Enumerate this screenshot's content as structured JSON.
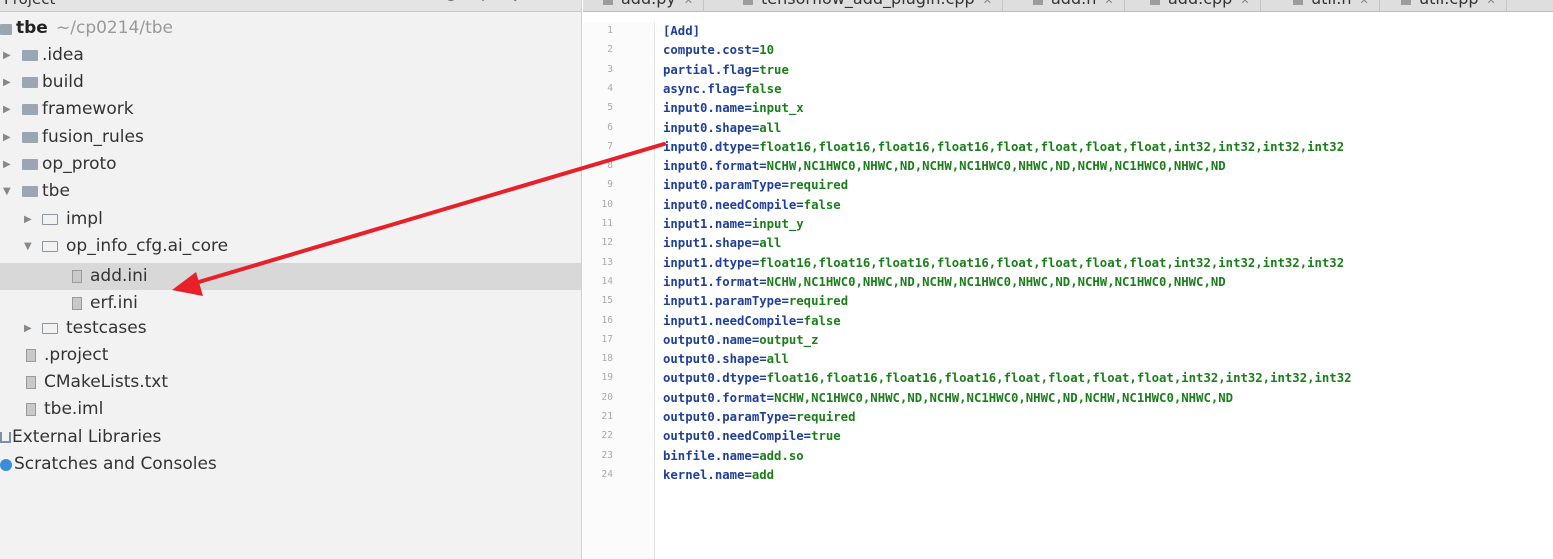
{
  "project_panel": {
    "title": "Project",
    "tree": [
      {
        "label": "tbe",
        "path": "~/cp0214/tbe",
        "kind": "root"
      },
      {
        "label": ".idea",
        "kind": "folder"
      },
      {
        "label": "build",
        "kind": "folder"
      },
      {
        "label": "framework",
        "kind": "folder"
      },
      {
        "label": "fusion_rules",
        "kind": "folder"
      },
      {
        "label": "op_proto",
        "kind": "folder"
      },
      {
        "label": "tbe",
        "kind": "folder-open"
      },
      {
        "label": "impl",
        "kind": "subfolder"
      },
      {
        "label": "op_info_cfg.ai_core",
        "kind": "subfolder-open"
      },
      {
        "label": "add.ini",
        "kind": "file",
        "selected": true
      },
      {
        "label": "erf.ini",
        "kind": "file"
      },
      {
        "label": "testcases",
        "kind": "subfolder"
      },
      {
        "label": ".project",
        "kind": "file"
      },
      {
        "label": "CMakeLists.txt",
        "kind": "file"
      },
      {
        "label": "tbe.iml",
        "kind": "file"
      },
      {
        "label": "External Libraries",
        "kind": "library"
      },
      {
        "label": "Scratches and Consoles",
        "kind": "scratch"
      }
    ]
  },
  "editor": {
    "tabs": [
      {
        "label": "add.py"
      },
      {
        "label": "tensorflow_add_plugin.cpp"
      },
      {
        "label": "add.h"
      },
      {
        "label": "add.cpp"
      },
      {
        "label": "util.h"
      },
      {
        "label": "util.cpp"
      }
    ],
    "lines": [
      {
        "n": "1",
        "k": "[Add]",
        "v": ""
      },
      {
        "n": "2",
        "k": "compute.cost",
        "v": "10"
      },
      {
        "n": "3",
        "k": "partial.flag",
        "v": "true"
      },
      {
        "n": "4",
        "k": "async.flag",
        "v": "false"
      },
      {
        "n": "5",
        "k": "input0.name",
        "v": "input_x"
      },
      {
        "n": "6",
        "k": "input0.shape",
        "v": "all"
      },
      {
        "n": "7",
        "k": "input0.dtype",
        "v": "float16,float16,float16,float16,float,float,float,float,int32,int32,int32,int32"
      },
      {
        "n": "8",
        "k": "input0.format",
        "v": "NCHW,NC1HWC0,NHWC,ND,NCHW,NC1HWC0,NHWC,ND,NCHW,NC1HWC0,NHWC,ND"
      },
      {
        "n": "9",
        "k": "input0.paramType",
        "v": "required"
      },
      {
        "n": "10",
        "k": "input0.needCompile",
        "v": "false"
      },
      {
        "n": "11",
        "k": "input1.name",
        "v": "input_y"
      },
      {
        "n": "12",
        "k": "input1.shape",
        "v": "all"
      },
      {
        "n": "13",
        "k": "input1.dtype",
        "v": "float16,float16,float16,float16,float,float,float,float,int32,int32,int32,int32"
      },
      {
        "n": "14",
        "k": "input1.format",
        "v": "NCHW,NC1HWC0,NHWC,ND,NCHW,NC1HWC0,NHWC,ND,NCHW,NC1HWC0,NHWC,ND"
      },
      {
        "n": "15",
        "k": "input1.paramType",
        "v": "required"
      },
      {
        "n": "16",
        "k": "input1.needCompile",
        "v": "false"
      },
      {
        "n": "17",
        "k": "output0.name",
        "v": "output_z"
      },
      {
        "n": "18",
        "k": "output0.shape",
        "v": "all"
      },
      {
        "n": "19",
        "k": "output0.dtype",
        "v": "float16,float16,float16,float16,float,float,float,float,int32,int32,int32,int32"
      },
      {
        "n": "20",
        "k": "output0.format",
        "v": "NCHW,NC1HWC0,NHWC,ND,NCHW,NC1HWC0,NHWC,ND,NCHW,NC1HWC0,NHWC,ND"
      },
      {
        "n": "21",
        "k": "output0.paramType",
        "v": "required"
      },
      {
        "n": "22",
        "k": "output0.needCompile",
        "v": "true"
      },
      {
        "n": "23",
        "k": "binfile.name",
        "v": "add.so"
      },
      {
        "n": "24",
        "k": "kernel.name",
        "v": "add"
      }
    ]
  },
  "colors": {
    "annotation_arrow": "#e8202a",
    "code_key": "#1f3f9a",
    "code_value": "#1a7f1a",
    "selection": "#d8d8d8"
  }
}
